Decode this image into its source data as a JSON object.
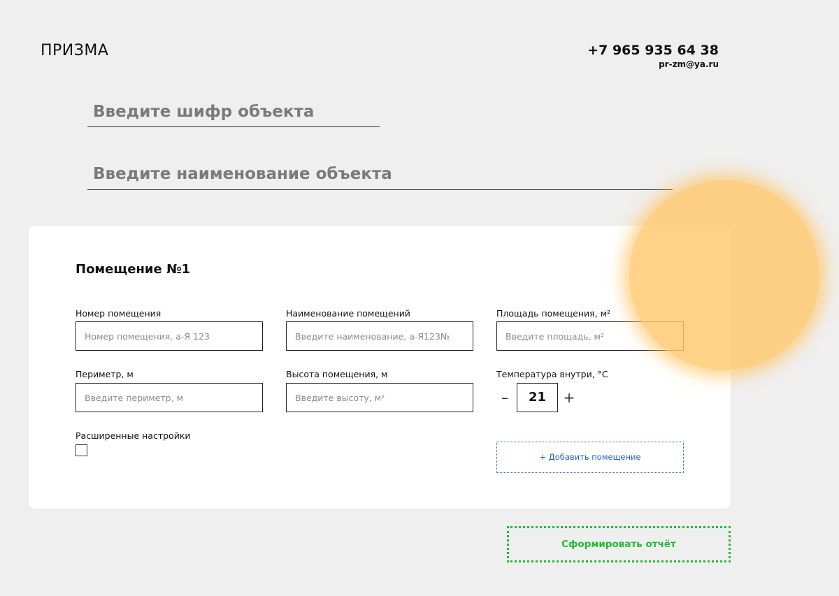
{
  "header": {
    "logo": "ПРИЗМА",
    "phone": "+7 965 935 64 38",
    "email": "pr-zm@ya.ru"
  },
  "object": {
    "code_placeholder": "Введите шифр объекта",
    "name_placeholder": "Введите наименование объекта"
  },
  "room": {
    "title": "Помещение №1",
    "fields": {
      "number": {
        "label": "Номер помещения",
        "placeholder": "Номер помещения, а-Я 123"
      },
      "name": {
        "label": "Наименование помещений",
        "placeholder": "Введите наименование, а-Я123№"
      },
      "area": {
        "label": "Площадь помещения, м²",
        "placeholder": "Введите площадь, м²"
      },
      "perimeter": {
        "label": "Периметр, м",
        "placeholder": "Введите периметр, м"
      },
      "height": {
        "label": "Высота помещения, м",
        "placeholder": "Введите высоту, м²"
      },
      "temperature": {
        "label": "Температура внутри, °С",
        "value": "21",
        "minus": "–",
        "plus": "+"
      }
    },
    "advanced_label": "Расширенные настройки",
    "add_room_label": "+ Добавить помещение"
  },
  "report_button_label": "Сформировать отчёт",
  "colors": {
    "accent_blue": "#1f5fbf",
    "accent_green": "#22bb33",
    "glow": "#ffc86e"
  }
}
